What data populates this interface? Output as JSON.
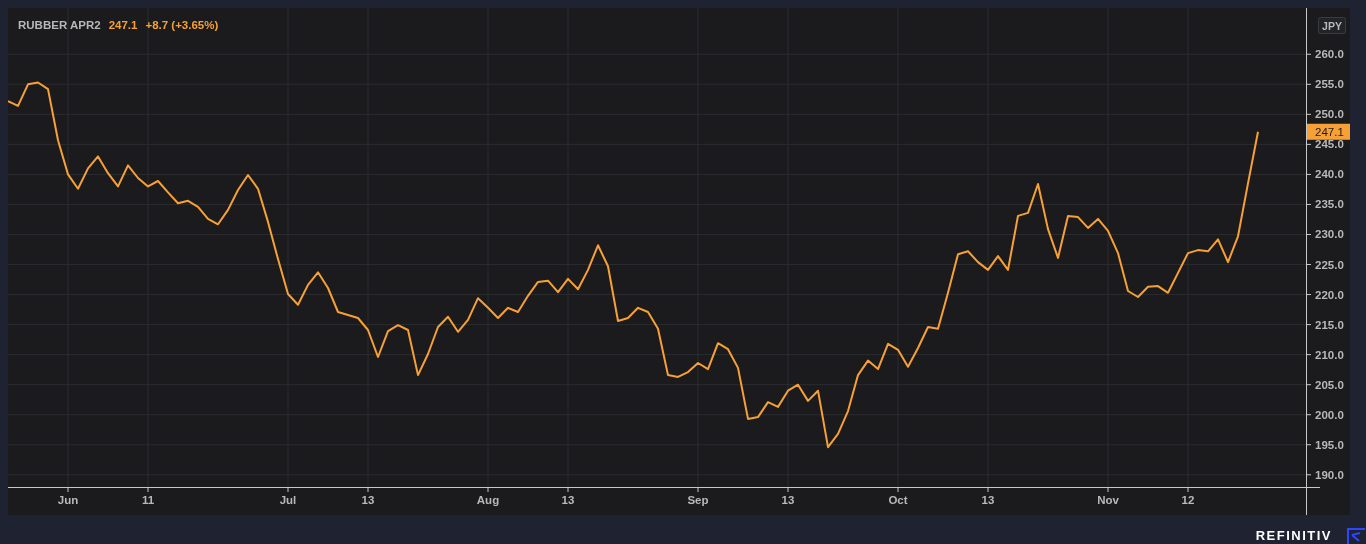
{
  "chart": {
    "legend": {
      "last": "247.1",
      "change": "+8.7 (+3.65%)"
    },
    "currency": "JPY",
    "price_label": "247.1",
    "chart_data": {
      "type": "line",
      "categories": [
        null,
        null,
        null,
        null,
        null,
        null,
        "Jun",
        null,
        null,
        null,
        null,
        null,
        null,
        null,
        "11",
        null,
        null,
        null,
        null,
        null,
        null,
        null,
        null,
        null,
        null,
        null,
        null,
        null,
        "Jul",
        null,
        null,
        null,
        null,
        null,
        null,
        null,
        "13",
        null,
        null,
        null,
        null,
        null,
        null,
        null,
        null,
        null,
        null,
        null,
        "Aug",
        null,
        null,
        null,
        null,
        null,
        null,
        null,
        "13",
        null,
        null,
        null,
        null,
        null,
        null,
        null,
        null,
        null,
        null,
        null,
        null,
        "Sep",
        null,
        null,
        null,
        null,
        null,
        null,
        null,
        null,
        "13",
        null,
        null,
        null,
        null,
        null,
        null,
        null,
        null,
        null,
        null,
        "Oct",
        null,
        null,
        null,
        null,
        null,
        null,
        null,
        null,
        "13",
        null,
        null,
        null,
        null,
        null,
        null,
        null,
        null,
        null,
        null,
        null,
        "Nov",
        null,
        null,
        null,
        null,
        null,
        null,
        null,
        "12",
        null,
        null,
        null,
        null,
        null,
        null,
        null
      ],
      "series": [
        {
          "name": "RUBBER APR2",
          "color": "#f7a035",
          "values": [
            252.2,
            251.4,
            255.0,
            255.3,
            254.2,
            245.7,
            240.0,
            237.6,
            241.0,
            243.0,
            240.2,
            238.0,
            241.5,
            239.4,
            238.0,
            238.9,
            237.0,
            235.2,
            235.6,
            234.6,
            232.6,
            231.7,
            234.1,
            237.4,
            239.9,
            237.6,
            232.1,
            225.9,
            220.1,
            218.3,
            221.6,
            223.7,
            221.1,
            217.1,
            216.6,
            216.1,
            214.1,
            209.6,
            213.9,
            214.9,
            214.1,
            206.6,
            210.1,
            214.6,
            216.3,
            213.8,
            215.8,
            219.4,
            217.8,
            216.1,
            217.8,
            217.1,
            219.8,
            222.1,
            222.3,
            220.4,
            222.6,
            220.9,
            224.1,
            228.2,
            224.7,
            215.6,
            216.1,
            217.8,
            217.1,
            214.3,
            206.6,
            206.3,
            207.1,
            208.6,
            207.6,
            211.9,
            210.9,
            207.8,
            199.3,
            199.6,
            202.1,
            201.3,
            204.0,
            205.0,
            202.3,
            204.0,
            194.6,
            196.8,
            200.6,
            206.6,
            209.0,
            207.6,
            211.8,
            210.8,
            208.0,
            211.1,
            214.6,
            214.3,
            220.3,
            226.7,
            227.2,
            225.4,
            224.1,
            226.4,
            224.1,
            233.1,
            233.6,
            238.4,
            230.9,
            226.1,
            233.1,
            232.9,
            231.1,
            232.6,
            230.6,
            226.9,
            220.6,
            219.6,
            221.3,
            221.4,
            220.3,
            223.6,
            226.9,
            227.4,
            227.2,
            229.2,
            225.4,
            229.7,
            238.5,
            247.1
          ]
        }
      ],
      "ylim": [
        188.3,
        267.7
      ],
      "grid": true,
      "yticks": [
        {
          "value": 190,
          "label": "190.0"
        },
        {
          "value": 195,
          "label": "195.0"
        },
        {
          "value": 200,
          "label": "200.0"
        },
        {
          "value": 205,
          "label": "205.0"
        },
        {
          "value": 210,
          "label": "210.0"
        },
        {
          "value": 215,
          "label": "215.0"
        },
        {
          "value": 220,
          "label": "220.0"
        },
        {
          "value": 225,
          "label": "225.0"
        },
        {
          "value": 230,
          "label": "230.0"
        },
        {
          "value": 235,
          "label": "235.0"
        },
        {
          "value": 240,
          "label": "240.0"
        },
        {
          "value": 245,
          "label": "245.0"
        },
        {
          "value": 250,
          "label": "250.0"
        },
        {
          "value": 255,
          "label": "255.0"
        },
        {
          "value": 260,
          "label": "260.0"
        }
      ]
    }
  },
  "footer": {
    "brand": "REFINITIV"
  }
}
